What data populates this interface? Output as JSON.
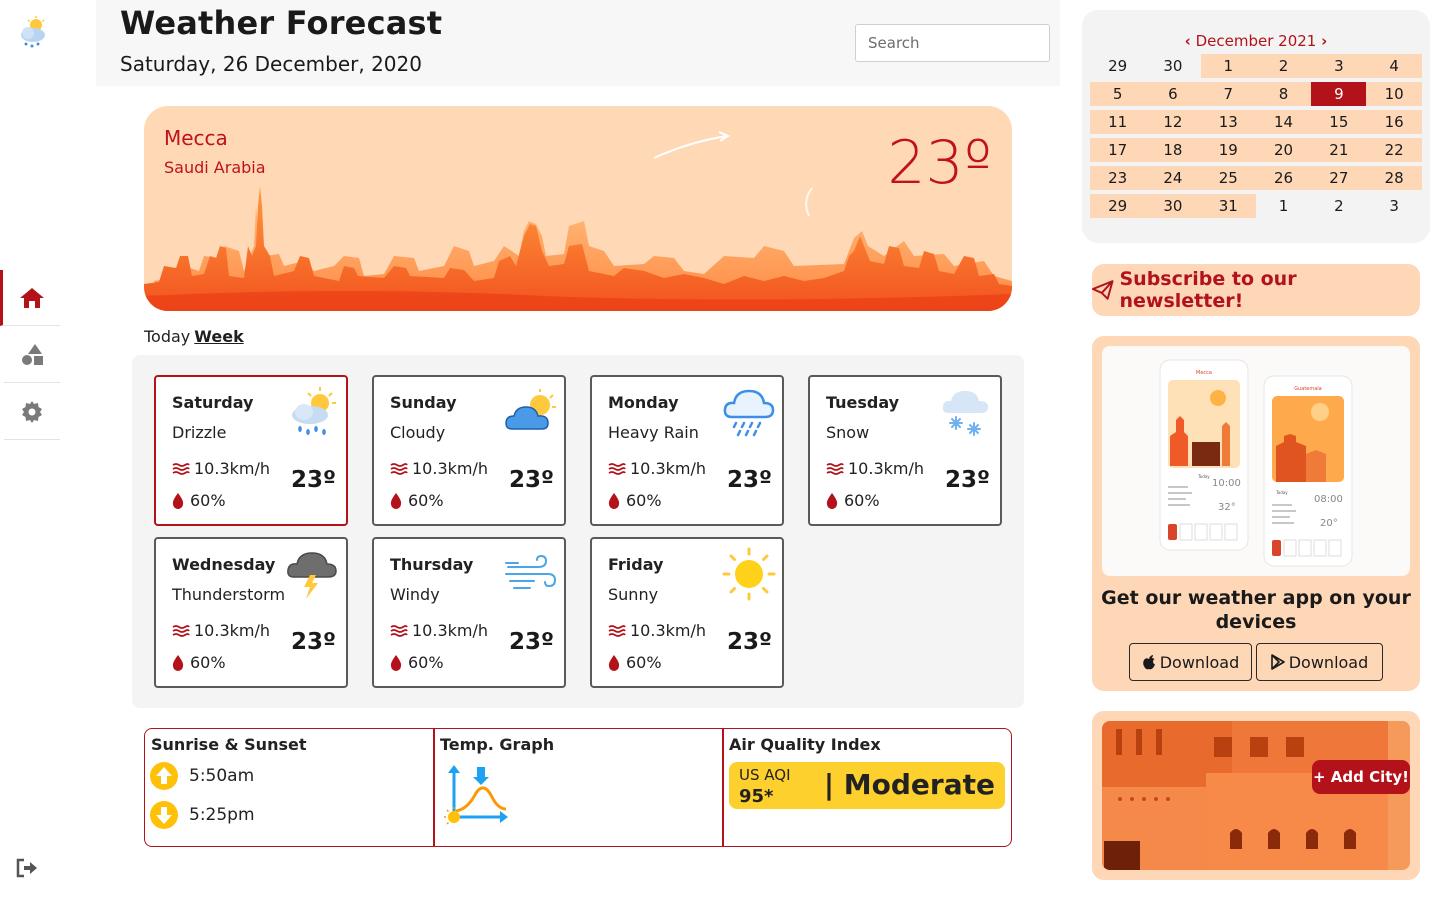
{
  "app": {
    "title": "Weather Forecast",
    "date": "Saturday, 26 December, 2020"
  },
  "search": {
    "placeholder": "Search"
  },
  "sidebar": {
    "items": [
      {
        "icon": "home-icon",
        "active": true
      },
      {
        "icon": "shapes-icon",
        "active": false
      },
      {
        "icon": "gear-icon",
        "active": false
      }
    ],
    "logout_icon": "logout-icon"
  },
  "hero": {
    "city": "Mecca",
    "country": "Saudi Arabia",
    "temperature": "23º"
  },
  "tabs": {
    "today": "Today",
    "week": "Week",
    "active": "week"
  },
  "days": [
    {
      "name": "Saturday",
      "condition": "Drizzle",
      "wind": "10.3km/h",
      "humidity": "60%",
      "temp": "23º",
      "icon": "drizzle-icon",
      "selected": true
    },
    {
      "name": "Sunday",
      "condition": "Cloudy",
      "wind": "10.3km/h",
      "humidity": "60%",
      "temp": "23º",
      "icon": "cloudy-icon",
      "selected": false
    },
    {
      "name": "Monday",
      "condition": "Heavy Rain",
      "wind": "10.3km/h",
      "humidity": "60%",
      "temp": "23º",
      "icon": "heavy-rain-icon",
      "selected": false
    },
    {
      "name": "Tuesday",
      "condition": "Snow",
      "wind": "10.3km/h",
      "humidity": "60%",
      "temp": "23º",
      "icon": "snow-icon",
      "selected": false
    },
    {
      "name": "Wednesday",
      "condition": "Thunderstorm",
      "wind": "10.3km/h",
      "humidity": "60%",
      "temp": "23º",
      "icon": "thunderstorm-icon",
      "selected": false
    },
    {
      "name": "Thursday",
      "condition": "Windy",
      "wind": "10.3km/h",
      "humidity": "60%",
      "temp": "23º",
      "icon": "windy-icon",
      "selected": false
    },
    {
      "name": "Friday",
      "condition": "Sunny",
      "wind": "10.3km/h",
      "humidity": "60%",
      "temp": "23º",
      "icon": "sunny-icon",
      "selected": false
    }
  ],
  "info": {
    "sun": {
      "title": "Sunrise & Sunset",
      "sunrise": "5:50am",
      "sunset": "5:25pm"
    },
    "graph": {
      "title": "Temp. Graph"
    },
    "aqi": {
      "title": "Air Quality Index",
      "label": "US AQI",
      "value": "95*",
      "status": "| Moderate"
    }
  },
  "calendar": {
    "month": "December 2021",
    "weeks": [
      [
        {
          "d": "29",
          "m": false
        },
        {
          "d": "30",
          "m": false
        },
        {
          "d": "1",
          "m": true
        },
        {
          "d": "2",
          "m": true
        },
        {
          "d": "3",
          "m": true
        },
        {
          "d": "4",
          "m": true
        }
      ],
      [
        {
          "d": "5",
          "m": true
        },
        {
          "d": "6",
          "m": true
        },
        {
          "d": "7",
          "m": true
        },
        {
          "d": "8",
          "m": true
        },
        {
          "d": "9",
          "m": true,
          "today": true
        },
        {
          "d": "10",
          "m": true
        }
      ],
      [
        {
          "d": "11",
          "m": true
        },
        {
          "d": "12",
          "m": true
        },
        {
          "d": "13",
          "m": true
        },
        {
          "d": "14",
          "m": true
        },
        {
          "d": "15",
          "m": true
        },
        {
          "d": "16",
          "m": true
        }
      ],
      [
        {
          "d": "17",
          "m": true
        },
        {
          "d": "18",
          "m": true
        },
        {
          "d": "19",
          "m": true
        },
        {
          "d": "20",
          "m": true
        },
        {
          "d": "21",
          "m": true
        },
        {
          "d": "22",
          "m": true
        }
      ],
      [
        {
          "d": "23",
          "m": true
        },
        {
          "d": "24",
          "m": true
        },
        {
          "d": "25",
          "m": true
        },
        {
          "d": "26",
          "m": true
        },
        {
          "d": "27",
          "m": true
        },
        {
          "d": "28",
          "m": true
        }
      ],
      [
        {
          "d": "29",
          "m": true
        },
        {
          "d": "30",
          "m": true
        },
        {
          "d": "31",
          "m": true
        },
        {
          "d": "1",
          "m": false
        },
        {
          "d": "2",
          "m": false
        },
        {
          "d": "3",
          "m": false
        }
      ]
    ]
  },
  "newsletter": {
    "label": "Subscribe to our newsletter!"
  },
  "app_promo": {
    "text": "Get our weather app on your devices",
    "ios_label": "Download",
    "android_label": "Download",
    "phone1": {
      "city": "Mecca",
      "time": "10:00",
      "temp": "32°"
    },
    "phone2": {
      "city": "Guatemala",
      "time": "08:00",
      "temp": "20°"
    }
  },
  "city_promo": {
    "button": "+ Add City!"
  },
  "colors": {
    "accent": "#b3121b",
    "peach": "#fed7b7",
    "aqi": "#fed02d"
  }
}
